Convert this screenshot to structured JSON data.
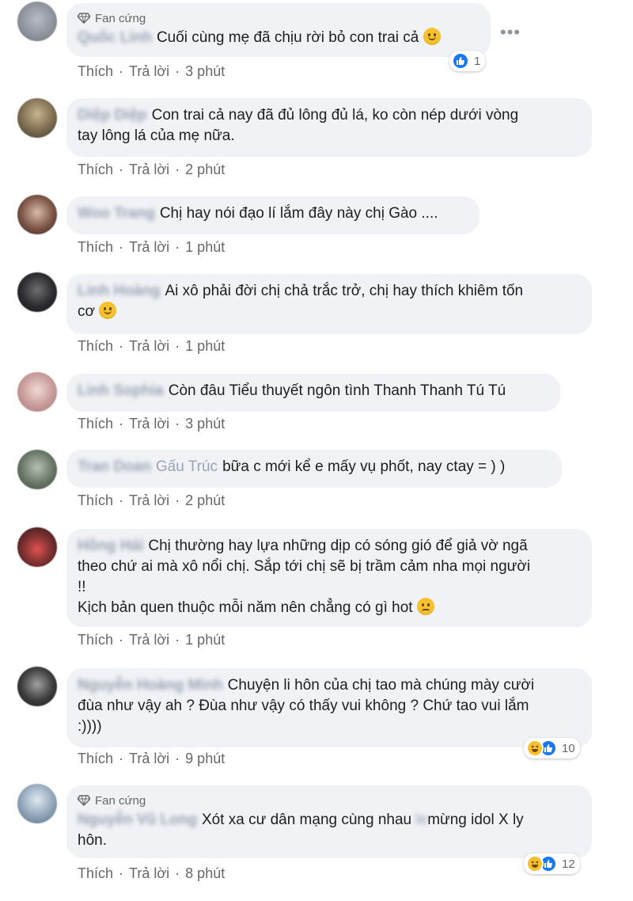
{
  "ui": {
    "fan_badge": "Fan cứng",
    "like_label": "Thích",
    "reply_label": "Trả lời",
    "more_icon": "more-dots-icon"
  },
  "comments": [
    {
      "author": "Quốc Linh",
      "fan": true,
      "lines": [
        "Cuối cùng mẹ đã chịu rời bỏ con trai cả"
      ],
      "emoji_end": "smile",
      "time": "3 phút",
      "reactions": {
        "types": [
          "like"
        ],
        "count": "1"
      }
    },
    {
      "author": "Diệp Diệp",
      "fan": false,
      "lines": [
        "Con trai cả nay đã đủ lông đủ lá, ko còn nép dưới vòng",
        "tay lông lá của mẹ nữa."
      ],
      "time": "2 phút"
    },
    {
      "author": "Woo Trang",
      "fan": false,
      "lines": [
        "Chị hay nói đạo lí lắm đây này chị Gào ...."
      ],
      "time": "1 phút"
    },
    {
      "author": "Linh Hoàng",
      "fan": false,
      "lines": [
        "Ai xô phải đời chị chả trắc trở, chị hay thích khiêm tốn",
        "cơ"
      ],
      "emoji_end": "smile",
      "time": "1 phút"
    },
    {
      "author": "Linh Sophia",
      "fan": false,
      "lines": [
        "Còn đâu Tiểu thuyết ngôn tình Thanh Thanh Tú Tú"
      ],
      "time": "3 phút"
    },
    {
      "author": "Tran Doan",
      "author_visible": "Gấu Trúc",
      "fan": false,
      "lines": [
        "bữa c mới kể e mấy vụ phốt, nay ctay = ) )"
      ],
      "time": "2 phút"
    },
    {
      "author": "Hồng Hải",
      "fan": false,
      "lines": [
        "Chị thường hay lựa những dịp có sóng gió để giả vờ ngã",
        "theo chứ ai mà xô nổi chị. Sắp tới chị sẽ bị trầm cảm nha mọi người",
        "!!",
        "Kịch bản quen thuộc mỗi năm nên chẳng có gì hot"
      ],
      "emoji_end": "pensive",
      "time": "1 phút"
    },
    {
      "author": "Nguyễn Hoàng Minh",
      "fan": false,
      "lines": [
        "Chuyện li hôn của chị tao mà chúng mày cười",
        "đùa như vậy ah ? Đùa như vậy có thấy vui không ? Chứ tao vui lắm",
        ":))))"
      ],
      "time": "9 phút",
      "reactions": {
        "types": [
          "haha",
          "like"
        ],
        "count": "10"
      }
    },
    {
      "author": "Nguyễn Vũ Long",
      "fan": true,
      "lines": [
        "Xót xa cư dân mạng cùng nhau ",
        "mừng idol X ly",
        "hôn."
      ],
      "time": "8 phút",
      "reactions": {
        "types": [
          "haha",
          "like"
        ],
        "count": "12"
      }
    }
  ],
  "colors": {
    "bubble": "#f0f2f5",
    "action_text": "#65676b",
    "like_blue": "#1877f2",
    "haha_yellow": "#f7c12d"
  }
}
